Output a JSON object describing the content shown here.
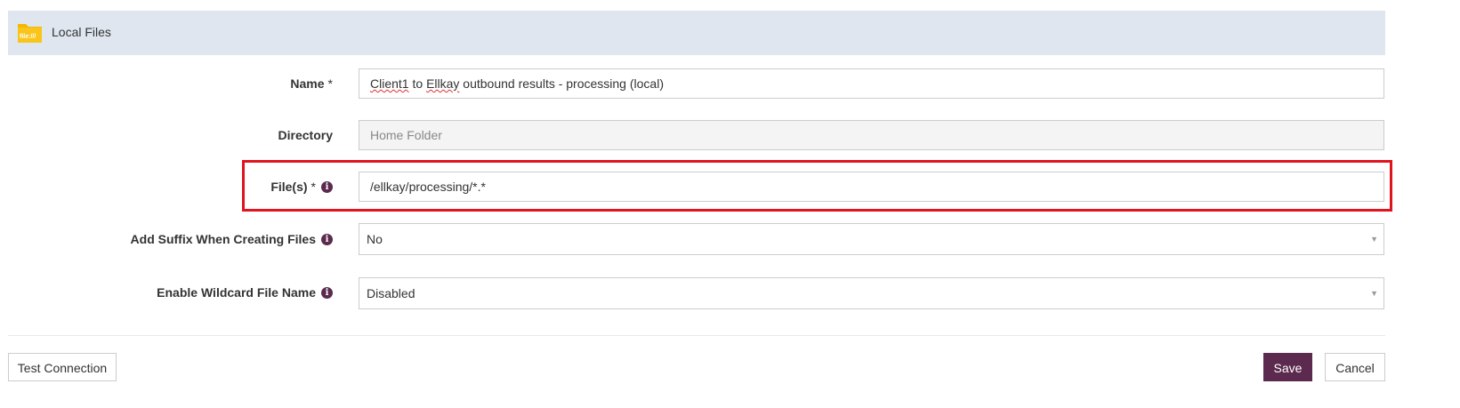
{
  "header": {
    "title": "Local Files",
    "icon": "folder-file-icon",
    "icon_text": "file:///"
  },
  "fields": {
    "name": {
      "label": "Name",
      "required": "*",
      "value_part1": "Client1",
      "value_part2": " to ",
      "value_part3": "Ellkay",
      "value_part4": " outbound results - processing (local)"
    },
    "directory": {
      "label": "Directory",
      "placeholder": "Home Folder"
    },
    "files": {
      "label": "File(s)",
      "required": "*",
      "value": "/ellkay/processing/*.*"
    },
    "suffix": {
      "label": "Add Suffix When Creating Files",
      "value": "No"
    },
    "wildcard": {
      "label": "Enable Wildcard File Name",
      "value": "Disabled"
    }
  },
  "buttons": {
    "test": "Test Connection",
    "save": "Save",
    "cancel": "Cancel"
  },
  "icons": {
    "info": "i",
    "arrow": "▼"
  },
  "colors": {
    "accent": "#5b2a4e",
    "header_bg": "#dfe6f0",
    "highlight": "#e0141e"
  }
}
